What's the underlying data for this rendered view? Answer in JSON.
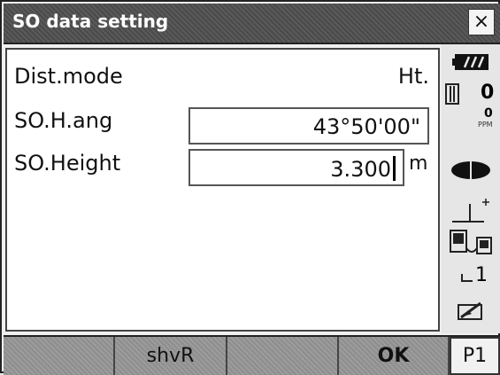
{
  "window": {
    "title": "SO data setting",
    "close_glyph": "×"
  },
  "form": {
    "dist_mode_label": "Dist.mode",
    "dist_mode_value": "Ht.",
    "so_h_ang_label": "SO.H.ang",
    "so_h_ang_value": "43°50'00\"",
    "so_height_label": "SO.Height",
    "so_height_value": "3.300",
    "so_height_unit": "m"
  },
  "status": {
    "prism_constant": "0",
    "ppm_value": "0",
    "ppm_label": "PPM",
    "channel": "1",
    "icons": [
      "battery-icon",
      "prism-icon",
      "laser-icon",
      "tilt-icon",
      "communication-icon",
      "input-mode-icon",
      "memory-icon"
    ]
  },
  "softkeys": [
    "",
    "shvR",
    "",
    "OK"
  ],
  "page_indicator": "P1"
}
